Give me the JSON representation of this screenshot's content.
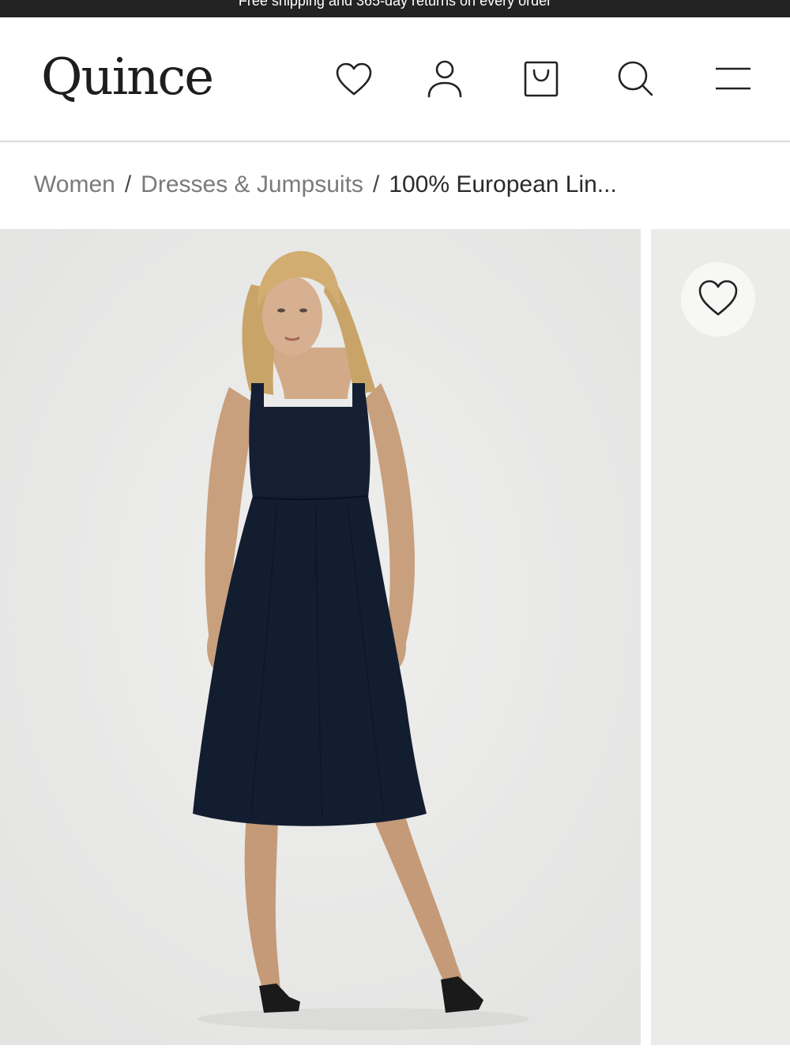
{
  "promo": {
    "text": "Free shipping and 365-day returns on every order"
  },
  "header": {
    "logo": "Quince",
    "icons": [
      "heart-icon",
      "user-icon",
      "shopping-bag-icon",
      "search-icon",
      "menu-icon"
    ]
  },
  "breadcrumb": {
    "items": [
      "Women",
      "Dresses & Jumpsuits"
    ],
    "separator": "/",
    "current": "100% European Lin..."
  },
  "gallery": {
    "wishlist_icon": "heart-icon"
  },
  "colors": {
    "promo_bg": "#232323",
    "dress": "#141f33",
    "photo_bg": "#ebebea"
  }
}
